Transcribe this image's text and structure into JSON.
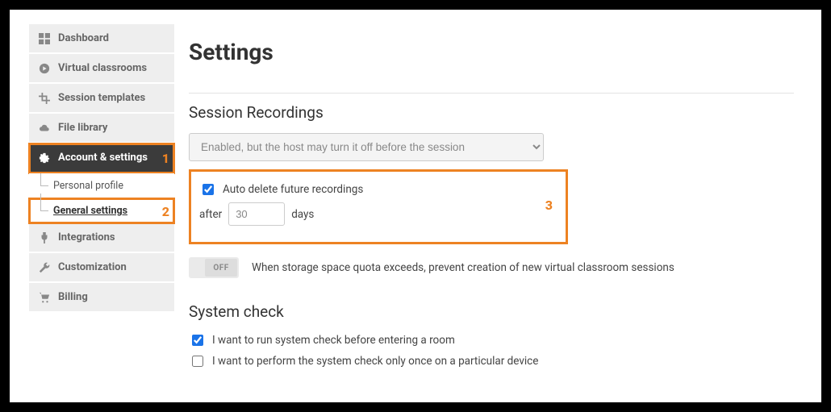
{
  "sidebar": {
    "items": [
      {
        "label": "Dashboard"
      },
      {
        "label": "Virtual classrooms"
      },
      {
        "label": "Session templates"
      },
      {
        "label": "File library"
      },
      {
        "label": "Account & settings"
      },
      {
        "label": "Integrations"
      },
      {
        "label": "Customization"
      },
      {
        "label": "Billing"
      }
    ],
    "sub": {
      "personal": "Personal profile",
      "general": "General settings"
    }
  },
  "annotations": {
    "num1": "1",
    "num2": "2",
    "num3": "3"
  },
  "page": {
    "title": "Settings"
  },
  "recordings": {
    "section_title": "Session Recordings",
    "select_value": "Enabled, but the host may turn it off before the session",
    "auto_delete_label": "Auto delete future recordings",
    "after_label": "after",
    "days_value": "30",
    "days_label": "days",
    "toggle_state": "OFF",
    "toggle_desc": "When storage space quota exceeds, prevent creation of new virtual classroom sessions"
  },
  "system_check": {
    "section_title": "System check",
    "opt1": "I want to run system check before entering a room",
    "opt2": "I want to perform the system check only once on a particular device"
  }
}
